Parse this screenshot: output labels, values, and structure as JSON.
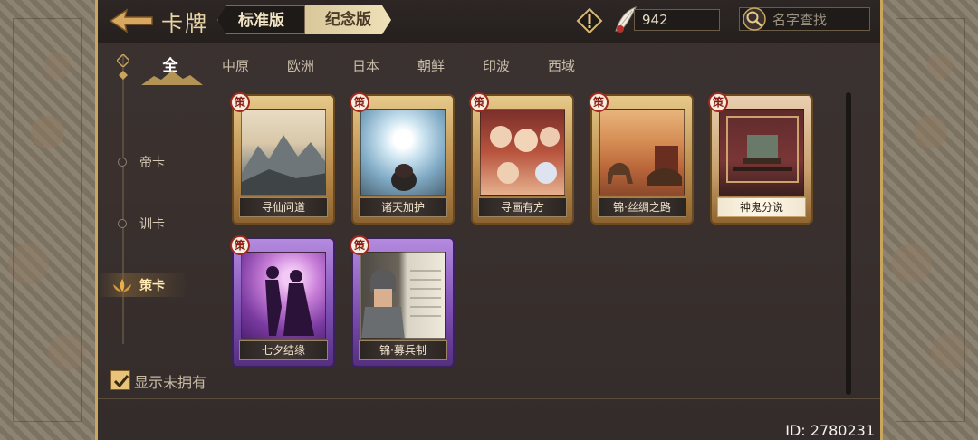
{
  "header": {
    "title": "卡牌",
    "version_tabs": [
      {
        "label": "标准版",
        "active": true
      },
      {
        "label": "纪念版",
        "active": false
      }
    ],
    "coin_count": "942",
    "search_placeholder": "名字查找"
  },
  "regions": [
    {
      "label": "全",
      "active": true
    },
    {
      "label": "中原",
      "active": false
    },
    {
      "label": "欧洲",
      "active": false
    },
    {
      "label": "日本",
      "active": false
    },
    {
      "label": "朝鲜",
      "active": false
    },
    {
      "label": "印波",
      "active": false
    },
    {
      "label": "西域",
      "active": false
    }
  ],
  "categories": [
    {
      "label": "帝卡",
      "active": false
    },
    {
      "label": "训卡",
      "active": false
    },
    {
      "label": "策卡",
      "active": true
    }
  ],
  "cards": [
    {
      "name": "寻仙问道",
      "badge": "策",
      "frame": "gold"
    },
    {
      "name": "诸天加护",
      "badge": "策",
      "frame": "gold"
    },
    {
      "name": "寻画有方",
      "badge": "策",
      "frame": "gold"
    },
    {
      "name": "锦·丝绸之路",
      "badge": "策",
      "frame": "gold"
    },
    {
      "name": "神鬼分说",
      "badge": "策",
      "frame": "red"
    },
    {
      "name": "七夕结缘",
      "badge": "策",
      "frame": "purple"
    },
    {
      "name": "锦·募兵制",
      "badge": "策",
      "frame": "purple"
    }
  ],
  "show_unowned_label": "显示未拥有",
  "show_unowned_checked": true,
  "user_id": "ID: 2780231",
  "colors": {
    "accent_gold": "#e6c98a",
    "purple_frame": "#7a4cae",
    "panel_bg": "#3a312f"
  }
}
